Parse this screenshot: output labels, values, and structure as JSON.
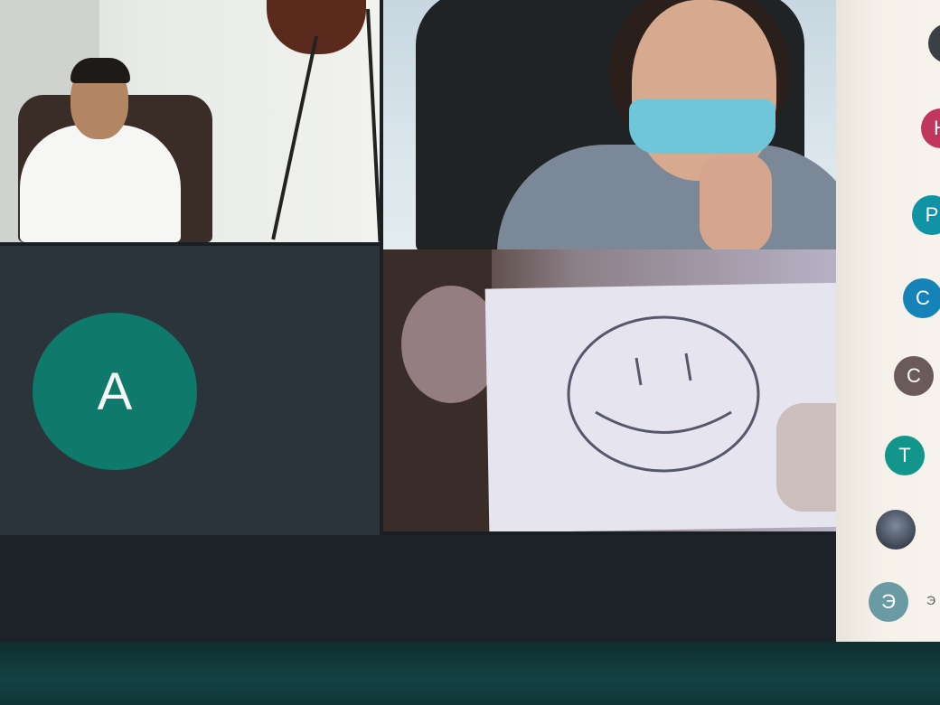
{
  "tiles": [
    {
      "id": "tile-1"
    },
    {
      "id": "tile-2"
    },
    {
      "id": "tile-3",
      "avatar_letter": "A",
      "avatar_color": "#0f7a6c"
    },
    {
      "id": "tile-4"
    }
  ],
  "participants": [
    {
      "letter": "",
      "color": "#3a4045"
    },
    {
      "letter": "H",
      "color": "#c0365d"
    },
    {
      "letter": "P",
      "color": "#1193a6"
    },
    {
      "letter": "C",
      "color": "#1582b8"
    },
    {
      "letter": "C",
      "color": "#6b5a5a"
    },
    {
      "letter": "T",
      "color": "#12958a"
    },
    {
      "letter": "",
      "color": "#8a8f96"
    },
    {
      "letter": "Э",
      "color": "#6a9aa3"
    }
  ],
  "participant_trailing_label": "Э"
}
